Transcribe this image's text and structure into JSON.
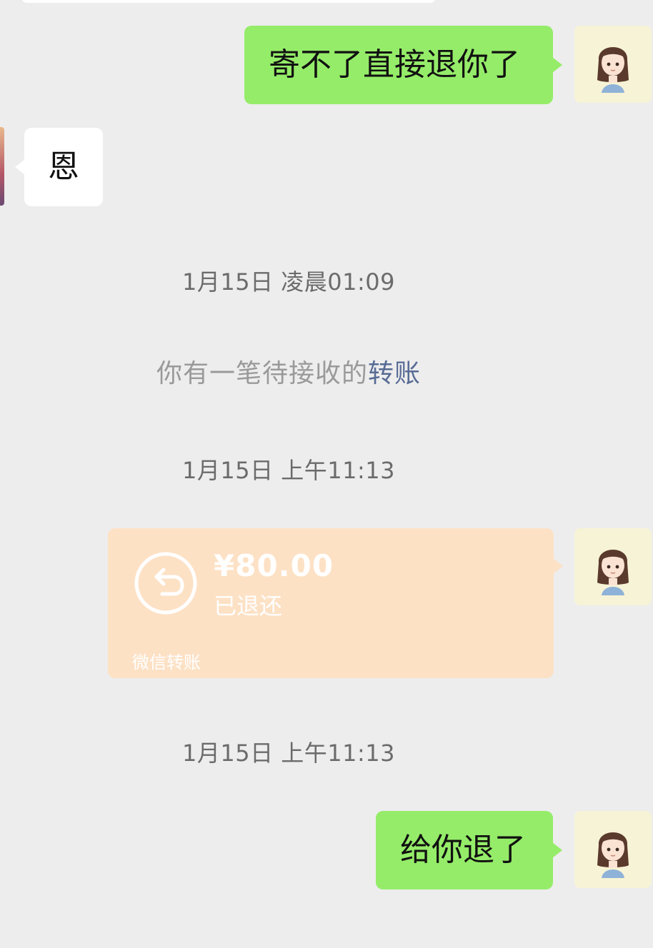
{
  "messages": {
    "msg1": {
      "text": "寄不了直接退你了"
    },
    "msg2": {
      "text": "恩"
    },
    "msg3": {
      "text": "给你退了"
    }
  },
  "timestamps": {
    "t1": "1月15日 凌晨01:09",
    "t2": "1月15日 上午11:13",
    "t3": "1月15日 上午11:13"
  },
  "system": {
    "prefix": "你有一笔待接收的",
    "link": "转账"
  },
  "transfer": {
    "amount": "¥80.00",
    "status": "已退还",
    "footer": "微信转账",
    "icon": "return-arrow-icon"
  },
  "colors": {
    "background": "#ededed",
    "bubble_green": "#95ec69",
    "bubble_white": "#ffffff",
    "transfer_card": "#fde1c5",
    "link": "#576b95"
  }
}
